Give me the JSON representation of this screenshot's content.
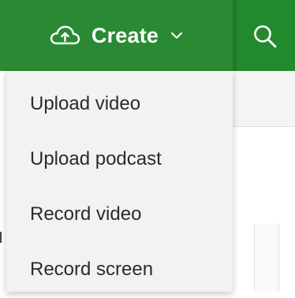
{
  "header": {
    "create_label": "Create",
    "create_icon": "upload-cloud-icon",
    "dropdown_icon": "chevron-down-icon",
    "search_icon": "search-icon",
    "brand_color": "#2a8a33"
  },
  "create_menu": {
    "items": [
      {
        "label": "Upload video"
      },
      {
        "label": "Upload podcast"
      },
      {
        "label": "Record video"
      },
      {
        "label": "Record screen"
      }
    ]
  }
}
